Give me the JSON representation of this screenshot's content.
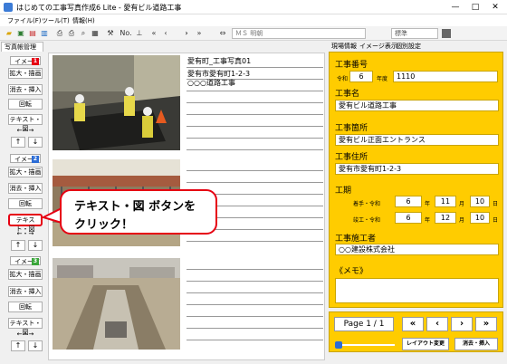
{
  "window": {
    "title": "はじめての工事写真作成6 Lite - 愛有ビル道路工事",
    "minimize": "—",
    "maximize": "□",
    "close": "✕"
  },
  "menu": {
    "items": [
      "ファイル(F)",
      "ツール(T)",
      "情報(H)"
    ]
  },
  "toolbar": {
    "icons": [
      "folder-open-icon",
      "save-icon",
      "copy-icon",
      "delete-icon",
      "print-preview-icon",
      "print-icon",
      "zoom-icon",
      "printer-icon",
      "wrench-icon",
      "numbering-icon",
      "format-icon",
      "first-icon",
      "prev-icon",
      "next-icon",
      "last-icon",
      "move-icon"
    ],
    "numbering_label": "No.",
    "font_name": "ＭＳ 明朝",
    "font_style": "標準"
  },
  "left": {
    "tab_label": "写真帳管理",
    "sections": [
      {
        "label": "イメージ",
        "number": "1",
        "number_color": "#e60012"
      },
      {
        "label": "イメージ",
        "number": "2",
        "number_color": "#2b6cd6"
      },
      {
        "label": "イメージ",
        "number": "3",
        "number_color": "#3aa63a"
      }
    ],
    "buttons": {
      "enlarge": "拡大・描画",
      "erase_insert": "消去・挿入",
      "rotate": "回転",
      "text_figure": "テキスト・図",
      "arrows": "←・→",
      "up": "↑",
      "down": "↓"
    }
  },
  "captions": {
    "photo1": [
      "愛有町_工事写真01",
      "愛有市愛有町1-2-3",
      "○○○道路工事"
    ]
  },
  "right_tabs": [
    "現場情報",
    "イメージ表示",
    "個別設定"
  ],
  "site_info": {
    "work_no_label": "工事番号",
    "era": "令和",
    "year": "6",
    "year_suffix": "年度",
    "number": "1110",
    "name_label": "工事名",
    "name": "愛有ビル道路工事",
    "place_label": "工事箇所",
    "place": "愛有ビル正面エントランス",
    "address_label": "工事住所",
    "address": "愛有市愛有町1-2-3",
    "period_label": "工期",
    "start_label": "着手",
    "end_label": "竣工",
    "era_prefix": "・令和",
    "start": {
      "y": "6",
      "m": "11",
      "d": "10"
    },
    "end": {
      "y": "6",
      "m": "12",
      "d": "10"
    },
    "y_unit": "年",
    "m_unit": "月",
    "d_unit": "日",
    "contractor_label": "工事施工者",
    "contractor": "○○建設株式会社",
    "memo_label": "《メモ》",
    "memo": ""
  },
  "nav": {
    "page": "Page  1 / 1",
    "first": "«",
    "prev": "‹",
    "next": "›",
    "last": "»",
    "layout_change": "レイアウト変更",
    "erase_insert": "消去・挿入"
  },
  "callout": {
    "line1": "テキスト・図 ボタンを",
    "line2": "クリック！",
    "color": "#e60012"
  }
}
